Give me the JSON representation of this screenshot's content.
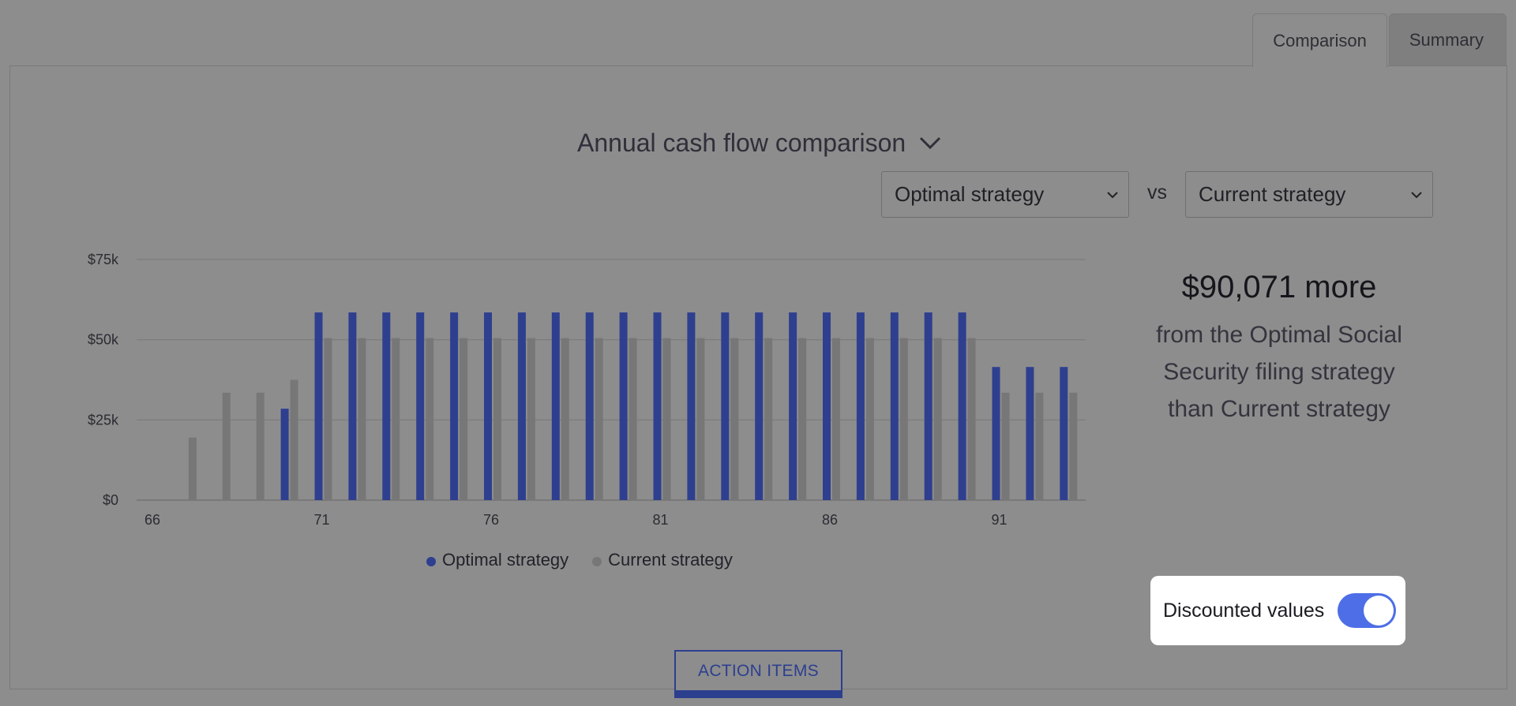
{
  "tabs": [
    {
      "label": "Comparison",
      "active": true
    },
    {
      "label": "Summary",
      "active": false
    }
  ],
  "chart_selector": {
    "label": "Annual cash flow comparison",
    "icon": "chevron-down-icon"
  },
  "compare": {
    "left": "Optimal strategy",
    "vs": "vs",
    "right": "Current strategy"
  },
  "summary": {
    "amount": "$90,071 more",
    "line1": "from the Optimal Social",
    "line2": "Security filing strategy",
    "line3": "than Current strategy"
  },
  "toggle": {
    "label": "Discounted values",
    "on": true
  },
  "action_button": "ACTION ITEMS",
  "colors": {
    "optimal": "#2f3f8f",
    "current": "#777777",
    "accent": "#4d6ee6"
  },
  "chart_data": {
    "type": "bar",
    "x": [
      66,
      67,
      68,
      69,
      70,
      71,
      72,
      73,
      74,
      75,
      76,
      77,
      78,
      79,
      80,
      81,
      82,
      83,
      84,
      85,
      86,
      87,
      88,
      89,
      90,
      91,
      92,
      93
    ],
    "x_tick_labels": [
      "66",
      "71",
      "76",
      "81",
      "86",
      "91"
    ],
    "y_tick_labels": [
      "$0",
      "$25k",
      "$50k",
      "$75k"
    ],
    "ylim": [
      0,
      75000
    ],
    "grid": true,
    "legend_position": "bottom",
    "series": [
      {
        "name": "Optimal strategy",
        "color": "#2f3f8f",
        "values": [
          0,
          0,
          0,
          0,
          28500,
          58500,
          58500,
          58500,
          58500,
          58500,
          58500,
          58500,
          58500,
          58500,
          58500,
          58500,
          58500,
          58500,
          58500,
          58500,
          58500,
          58500,
          58500,
          58500,
          58500,
          41500,
          41500,
          41500
        ]
      },
      {
        "name": "Current strategy",
        "color": "#777777",
        "values": [
          0,
          19500,
          33500,
          33500,
          37500,
          50500,
          50500,
          50500,
          50500,
          50500,
          50500,
          50500,
          50500,
          50500,
          50500,
          50500,
          50500,
          50500,
          50500,
          50500,
          50500,
          50500,
          50500,
          50500,
          50500,
          33500,
          33500,
          33500
        ]
      }
    ]
  }
}
